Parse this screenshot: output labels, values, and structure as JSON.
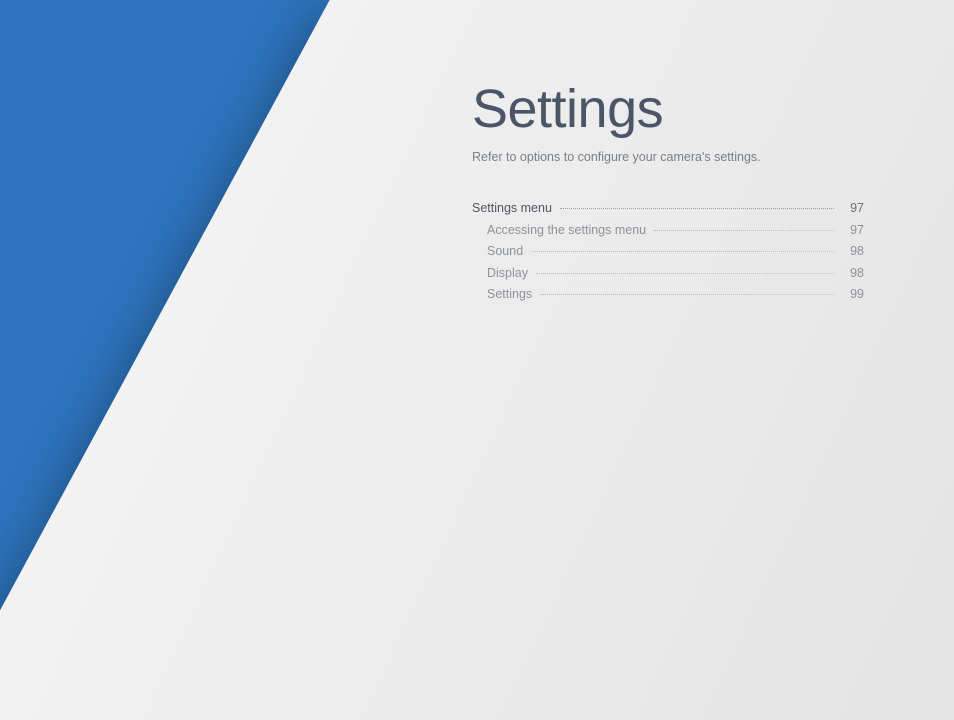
{
  "title": "Settings",
  "subtitle": "Refer to options to configure your camera's settings.",
  "toc": {
    "section": {
      "label": "Settings menu",
      "page": "97"
    },
    "items": [
      {
        "label": "Accessing the settings menu",
        "page": "97"
      },
      {
        "label": "Sound",
        "page": "98"
      },
      {
        "label": "Display",
        "page": "98"
      },
      {
        "label": "Settings",
        "page": "99"
      }
    ]
  }
}
